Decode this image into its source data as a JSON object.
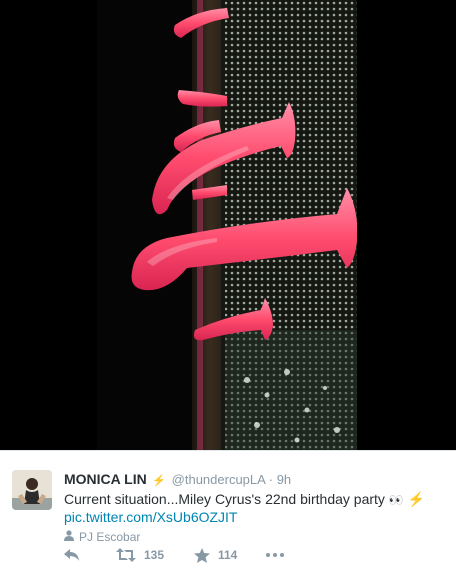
{
  "tweet": {
    "author_name": "MONICA LIN",
    "verified_glyph": "⚡",
    "handle": "@thundercupLA",
    "separator": "·",
    "time": "9h",
    "text": "Current situation...Miley Cyrus's 22nd birthday party",
    "emoji_eyes": "👀",
    "emoji_bolt": "⚡",
    "link": "pic.twitter.com/XsUb6OZJIT",
    "tagged_user": "PJ Escobar"
  },
  "actions": {
    "retweet_count": "135",
    "favorite_count": "114"
  },
  "icons": {
    "reply": "reply-icon",
    "retweet": "retweet-icon",
    "favorite": "star-icon",
    "more": "more-dots-icon",
    "tagged": "person-icon"
  },
  "colors": {
    "link": "#0084b4",
    "muted": "#8899a6",
    "text": "#292f33",
    "photo_glow": "#ff5a7e"
  }
}
